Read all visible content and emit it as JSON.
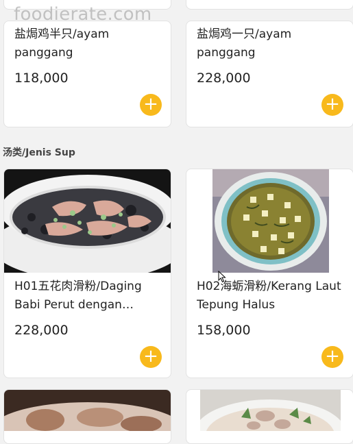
{
  "watermark": "foodierate.com",
  "items_top": [
    {
      "name": "盐焗鸡半只/ayam panggang",
      "price": "118,000"
    },
    {
      "name": "盐焗鸡一只/ayam panggang",
      "price": "228,000"
    }
  ],
  "section": {
    "title": "汤类/Jenis Sup"
  },
  "items_soup": [
    {
      "name": "H01五花肉滑粉/Daging Babi Perut dengan…",
      "price": "228,000"
    },
    {
      "name": "H02海蛎滑粉/Kerang Laut Tepung Halus",
      "price": "158,000"
    }
  ],
  "icons": {
    "add": "plus-icon",
    "cursor": "mouse-pointer-icon"
  },
  "colors": {
    "accent": "#f8b91c",
    "background": "#f2f2f2",
    "card": "#ffffff"
  }
}
